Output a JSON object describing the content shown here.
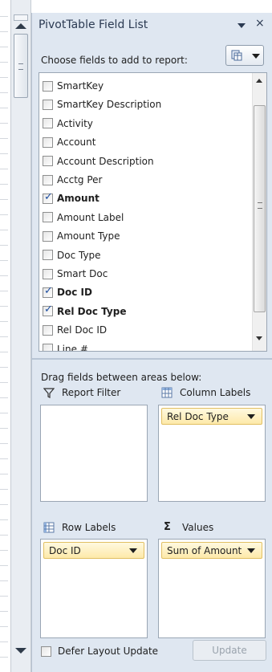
{
  "pane": {
    "title": "PivotTable Field List",
    "choose_label": "Choose fields to add to report:",
    "drag_label": "Drag fields between areas below:"
  },
  "fields": [
    {
      "label": "SmartKey",
      "checked": false
    },
    {
      "label": "SmartKey Description",
      "checked": false
    },
    {
      "label": "Activity",
      "checked": false
    },
    {
      "label": "Account",
      "checked": false
    },
    {
      "label": "Account Description",
      "checked": false
    },
    {
      "label": "Acctg Per",
      "checked": false
    },
    {
      "label": "Amount",
      "checked": true
    },
    {
      "label": "Amount Label",
      "checked": false
    },
    {
      "label": "Amount Type",
      "checked": false
    },
    {
      "label": "Doc Type",
      "checked": false
    },
    {
      "label": "Smart Doc",
      "checked": false
    },
    {
      "label": "Doc ID",
      "checked": true
    },
    {
      "label": "Rel Doc Type",
      "checked": true
    },
    {
      "label": "Rel Doc ID",
      "checked": false
    },
    {
      "label": "Line #",
      "checked": false
    }
  ],
  "areas": {
    "report_filter": {
      "label": "Report Filter",
      "icon": "filter-icon"
    },
    "column_labels": {
      "label": "Column Labels",
      "icon": "columns-icon",
      "chip": "Rel Doc Type"
    },
    "row_labels": {
      "label": "Row Labels",
      "icon": "rows-icon",
      "chip": "Doc ID"
    },
    "values": {
      "label": "Values",
      "icon": "sigma-icon",
      "symbol": "Σ",
      "chip": "Sum of Amount"
    }
  },
  "footer": {
    "defer_label": "Defer Layout Update",
    "update_label": "Update"
  },
  "icons": {
    "dropdown": "chevron-down-icon",
    "close": "close-icon",
    "close_glyph": "×",
    "checkmark": "✓",
    "layout": "layout-icon"
  },
  "colors": {
    "pane_bg": "#dfe7f1",
    "chip_border": "#e1bf62",
    "check": "#1d4ea0"
  }
}
